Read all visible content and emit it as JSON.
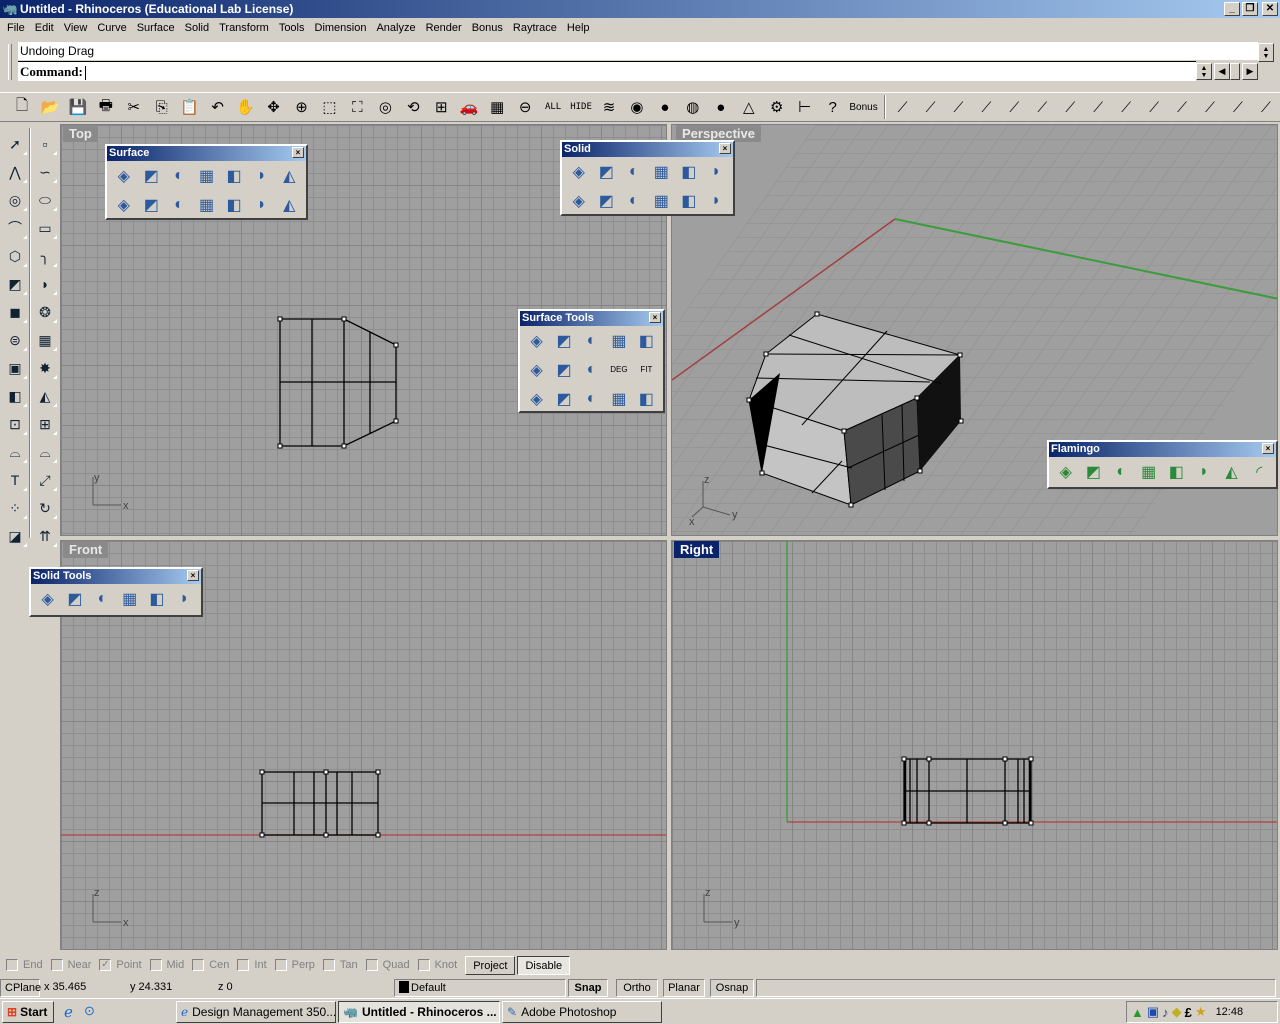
{
  "window": {
    "title": "Untitled - Rhinoceros (Educational Lab License)",
    "controls": {
      "minimize": "_",
      "maximize": "❐",
      "close": "✕"
    }
  },
  "menu": [
    "File",
    "Edit",
    "View",
    "Curve",
    "Surface",
    "Solid",
    "Transform",
    "Tools",
    "Dimension",
    "Analyze",
    "Render",
    "Bonus",
    "Raytrace",
    "Help"
  ],
  "command": {
    "history": "Undoing Drag",
    "prompt": "Command:",
    "value": ""
  },
  "toolbar": {
    "items": [
      {
        "name": "new-icon",
        "glyph": "🗋"
      },
      {
        "name": "open-icon",
        "glyph": "📂"
      },
      {
        "name": "save-icon",
        "glyph": "💾"
      },
      {
        "name": "print-icon",
        "glyph": "🖶"
      },
      {
        "name": "cut-icon",
        "glyph": "✂"
      },
      {
        "name": "copy-icon",
        "glyph": "⎘"
      },
      {
        "name": "paste-icon",
        "glyph": "📋"
      },
      {
        "name": "undo-icon",
        "glyph": "↶"
      },
      {
        "name": "pan-icon",
        "glyph": "✋"
      },
      {
        "name": "rotate-view-icon",
        "glyph": "✥"
      },
      {
        "name": "zoom-dynamic-icon",
        "glyph": "⊕"
      },
      {
        "name": "zoom-window-icon",
        "glyph": "⬚"
      },
      {
        "name": "zoom-extents-icon",
        "glyph": "⛶"
      },
      {
        "name": "zoom-selected-icon",
        "glyph": "◎"
      },
      {
        "name": "undo-view-icon",
        "glyph": "⟲"
      },
      {
        "name": "viewport-layout-icon",
        "glyph": "⊞"
      },
      {
        "name": "car-icon",
        "glyph": "🚗"
      },
      {
        "name": "cplane-icon",
        "glyph": "▦"
      },
      {
        "name": "point-on-icon",
        "glyph": "⊖"
      }
    ],
    "text_items": [
      "ALL",
      "HIDE"
    ],
    "items2": [
      {
        "name": "layers-icon",
        "glyph": "≋"
      },
      {
        "name": "color-wheel-icon",
        "glyph": "◉"
      },
      {
        "name": "shaded-sphere-icon",
        "glyph": "●"
      },
      {
        "name": "rendered-sphere-icon",
        "glyph": "◍"
      },
      {
        "name": "blue-sphere-icon",
        "glyph": "●"
      },
      {
        "name": "light-cone-icon",
        "glyph": "△"
      },
      {
        "name": "options-gear-icon",
        "glyph": "⚙"
      },
      {
        "name": "dimension-icon",
        "glyph": "⊢"
      },
      {
        "name": "help-icon",
        "glyph": "?"
      }
    ],
    "bonus_label": "Bonus",
    "curve_tools": [
      "line-icon",
      "polyline-icon",
      "line-segment-icon",
      "line-surface-normal-icon",
      "line-perpendicular-icon",
      "line-points-icon",
      "line-tangent-icon",
      "line-vertical-icon",
      "line-two-curves-icon",
      "line-angle-icon",
      "line-bisector-icon",
      "line-perp-curves-icon",
      "line-fit-icon",
      "line-extend-icon"
    ]
  },
  "left_toolbar": {
    "col1": [
      "select-arrow-icon",
      "polyline-icon",
      "circle-icon",
      "arc-icon",
      "polygon-icon",
      "surface-from-points-icon",
      "box-icon",
      "cylinder-mesh-icon",
      "group-icon",
      "split-icon",
      "array-icon",
      "curve-edit-icon",
      "text-icon",
      "point-cloud-icon",
      "layer-icon"
    ],
    "col2": [
      "point-icon",
      "curve-icon",
      "ellipse-icon",
      "rectangle-icon",
      "fillet-curve-icon",
      "sweep-icon",
      "boolean-union-icon",
      "mesh-icon",
      "explode-icon",
      "trim-icon",
      "array-polar-icon",
      "curve-points-icon",
      "scale-icon",
      "rotate-icon",
      "plane-arrows-icon"
    ]
  },
  "viewports": {
    "top": {
      "label": "Top",
      "axes": {
        "v": "y",
        "h": "x"
      }
    },
    "perspective": {
      "label": "Perspective",
      "axes": {
        "a": "z",
        "b": "y",
        "c": "x"
      }
    },
    "front": {
      "label": "Front",
      "axes": {
        "v": "z",
        "h": "x"
      }
    },
    "right": {
      "label": "Right",
      "axes": {
        "v": "z",
        "h": "y"
      }
    }
  },
  "panels": {
    "surface": {
      "title": "Surface",
      "close": "×",
      "rows": [
        [
          "surface-corner-points-icon",
          "surface-edge-curves-icon",
          "surface-planar-icon",
          "surface-network-icon",
          "surface-extrude-icon",
          "surface-loft-icon",
          "surface-revolve-icon"
        ],
        [
          "surface-rail-revolve-icon",
          "surface-sweep1-icon",
          "surface-sweep2-icon",
          "surface-patch-icon",
          "surface-drape-icon",
          "surface-heightfield-icon",
          "surface-from-grid-icon"
        ]
      ]
    },
    "solid": {
      "title": "Solid",
      "close": "×",
      "rows": [
        [
          "box-icon",
          "sphere-icon",
          "ellipsoid-icon",
          "paraboloid-icon",
          "cone-icon",
          "truncated-cone-icon"
        ],
        [
          "cylinder-icon",
          "tube-icon",
          "torus-icon",
          "pipe-icon",
          "extrude-solid-icon",
          "extrude-curve-solid-icon"
        ]
      ]
    },
    "surface_tools": {
      "title": "Surface Tools",
      "close": "×",
      "deg_label": "DEG",
      "fit_label": "FIT",
      "rows": [
        [
          "extend-surface-icon",
          "fillet-surface-icon",
          "chamfer-surface-icon",
          "offset-surface-icon",
          "blend-surface-icon"
        ],
        [
          "match-surface-icon",
          "merge-surface-icon",
          "worker-icon",
          "change-degree-icon",
          "fit-icon"
        ],
        [
          "untrim-icon",
          "shrink-trimmed-icon",
          "rebuild-surface-icon",
          "split-edge-icon",
          "connect-surface-icon"
        ]
      ]
    },
    "flamingo": {
      "title": "Flamingo",
      "close": "×",
      "items": [
        "render-icon",
        "save-render-icon",
        "material-icon",
        "material-editor-icon",
        "environment-icon",
        "plant-icon",
        "light-icon",
        "flamingo-help-icon"
      ]
    },
    "solid_tools": {
      "title": "Solid Tools",
      "close": "×",
      "items": [
        "boolean-union-icon",
        "boolean-difference-icon",
        "boolean-intersection-icon",
        "fillet-edge-icon",
        "extract-surface-icon",
        "cap-planar-holes-icon"
      ]
    }
  },
  "osnap": {
    "items": [
      {
        "label": "End",
        "checked": false
      },
      {
        "label": "Near",
        "checked": false
      },
      {
        "label": "Point",
        "checked": true
      },
      {
        "label": "Mid",
        "checked": false
      },
      {
        "label": "Cen",
        "checked": false
      },
      {
        "label": "Int",
        "checked": false
      },
      {
        "label": "Perp",
        "checked": false
      },
      {
        "label": "Tan",
        "checked": false
      },
      {
        "label": "Quad",
        "checked": false
      },
      {
        "label": "Knot",
        "checked": false
      }
    ],
    "project_label": "Project",
    "disable_label": "Disable"
  },
  "status": {
    "cplane": "CPlane",
    "x": "x 35.465",
    "y": "y 24.331",
    "z": "z 0",
    "layer": "Default",
    "layer_color": "#000000",
    "snap": "Snap",
    "ortho": "Ortho",
    "planar": "Planar",
    "osnap": "Osnap"
  },
  "taskbar": {
    "start": "Start",
    "tasks": [
      {
        "label": "Design Management 350...",
        "icon": "ie-icon"
      },
      {
        "label": "Untitled - Rhinoceros ...",
        "icon": "rhino-icon",
        "active": true
      },
      {
        "label": "Adobe Photoshop",
        "icon": "photoshop-icon"
      }
    ],
    "clock": "12:48",
    "tray_icons": [
      "tray-pyramid-icon",
      "tray-network-icon",
      "tray-music-icon",
      "tray-pencil-icon",
      "tray-currency-icon",
      "tray-star-icon"
    ]
  },
  "colors": {
    "title_gradient_start": "#0a246a",
    "title_gradient_end": "#a6caf0",
    "viewport_bg": "#9f9f9f",
    "x_axis": "#b04040",
    "y_axis": "#3c9c3c"
  }
}
